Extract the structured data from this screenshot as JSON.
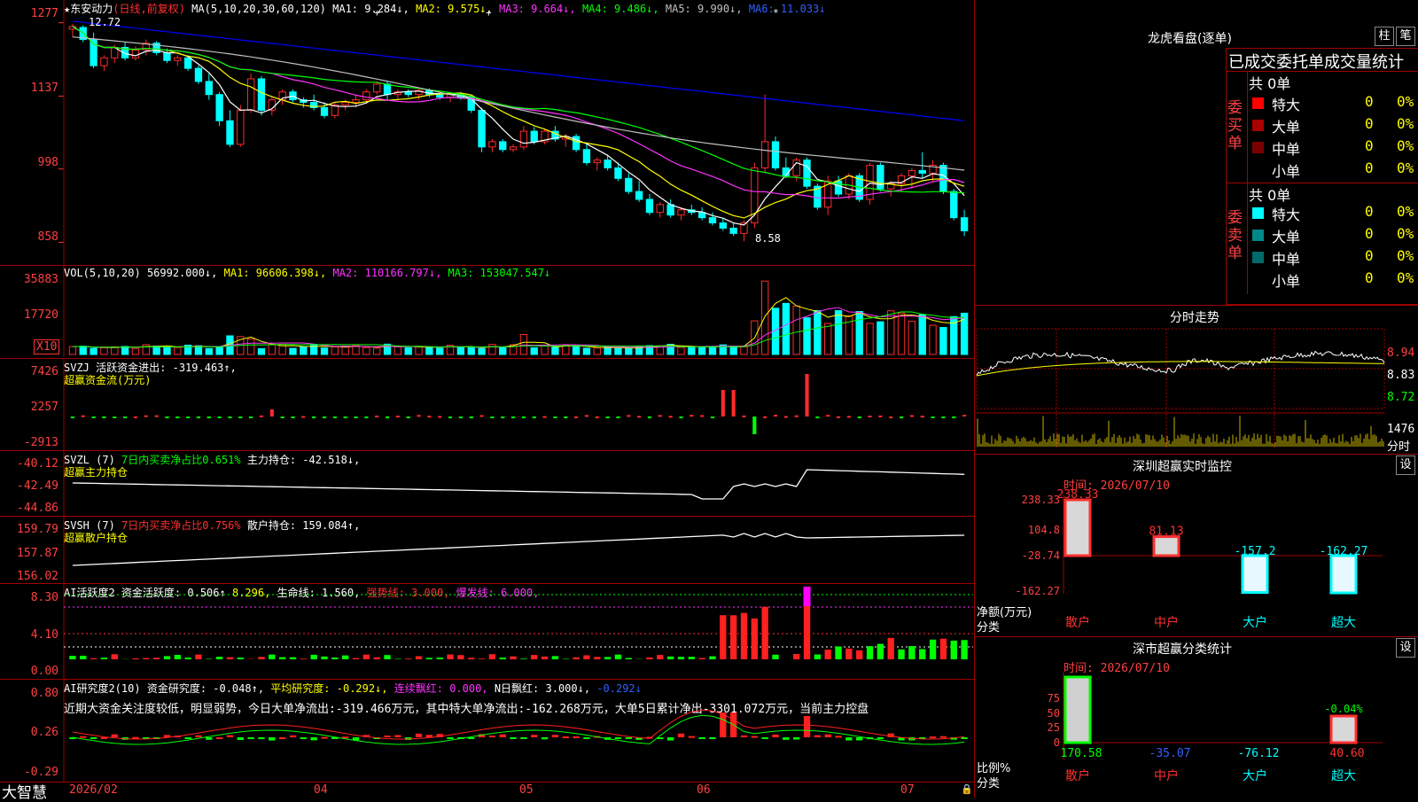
{
  "title_bar": {
    "stock_name": "东安动力",
    "period": "(日线,前复权)",
    "ma_label": "MA(5,10,20,30,60,120)",
    "ma1": "MA1: 9.284↓,",
    "ma2": "MA2: 9.575↓,",
    "ma3": "MA3: 9.664↓,",
    "ma4": "MA4: 9.486↓,",
    "ma5": "MA5: 9.990↓,",
    "ma6": "MA6: 11.033↓",
    "high_label": "12.72",
    "low_label": "8.58"
  },
  "price_axis": [
    "1277",
    "1137",
    "998",
    "858"
  ],
  "vol_panel": {
    "label": "VOL(5,10,20)",
    "value": "56992.000↓,",
    "ma1": "MA1: 96606.398↓,",
    "ma2": "MA2: 110166.797↓,",
    "ma3": "MA3: 153047.547↓",
    "axis": [
      "35883",
      "17720"
    ],
    "unit": "X10"
  },
  "svzj_panel": {
    "label": "SVZJ",
    "text": "活跃资金进出: -319.463↑,",
    "sub": "超赢资金流(万元)",
    "axis": [
      "7426",
      "2257",
      "-2913"
    ]
  },
  "svzl_panel": {
    "label": "SVZL (7)",
    "text1": "7日内买卖净占比0.651%",
    "text2": "主力持仓: -42.518↓,",
    "sub": "超赢主力持仓",
    "axis": [
      "-40.12",
      "-42.49",
      "-44.86"
    ]
  },
  "svsh_panel": {
    "label": "SVSH (7)",
    "text1": "7日内买卖净占比0.756%",
    "text2": "散户持仓: 159.084↑,",
    "sub": "超赢散户持仓",
    "axis": [
      "159.79",
      "157.87",
      "156.02"
    ]
  },
  "ai1_panel": {
    "label": "AI活跃度2",
    "t1": "资金活跃度: 0.506↑",
    "t2": "8.296,",
    "t3": "生命线: 1.560,",
    "t4": "强势线: 3.000,",
    "t5": "爆发线: 6.000,",
    "axis": [
      "8.30",
      "4.10",
      "0.00"
    ]
  },
  "ai2_panel": {
    "label": "AI研究度2(10)",
    "t1": "资金研究度: -0.048↑,",
    "t2": "平均研究度: -0.292↓,",
    "t3": "连续飘红: 0.000,",
    "t4": "N日飘红: 3.000↓,",
    "t5": "-0.292↓",
    "axis": [
      "0.80",
      "0.26",
      "-0.29"
    ],
    "comment": "近期大资金关注度较低，明显弱势，今日大单净流出:-319.466万元，其中特大单净流出:-162.268万元，大单5日累计净出-3301.072万元，当前主力控盘"
  },
  "date_axis": [
    "2026/02",
    "04",
    "05",
    "06",
    "07"
  ],
  "brand": "大智慧",
  "dragon_tiger": {
    "title": "龙虎看盘(逐单)",
    "btn1": "柱",
    "btn2": "笔",
    "header": "已成交委托单成交量统计",
    "buy_label": "委买单",
    "sell_label": "委卖单",
    "buy_total": "共 0单",
    "sell_total": "共 0单",
    "rows": [
      "特大",
      "大单",
      "中单",
      "小单"
    ],
    "count": "0",
    "pct": "0%"
  },
  "intraday": {
    "title": "分时走势",
    "price_axis": [
      "8.94",
      "8.83",
      "8.72"
    ],
    "vol_axis": "1476",
    "vol_unit": "分时"
  },
  "realtime_monitor": {
    "title": "深圳超赢实时监控",
    "btn": "设",
    "time": "时间: 2026/07/10",
    "axis": [
      "238.33",
      "104.8",
      "-28.74",
      "-162.27"
    ],
    "unit_label": "净额(万元)",
    "cat_label": "分类",
    "categories": [
      "散户",
      "中户",
      "大户",
      "超大"
    ],
    "values": [
      "238.33",
      "81.13",
      "-157.2",
      "-162.27"
    ]
  },
  "class_stats": {
    "title": "深市超赢分类统计",
    "btn": "设",
    "time": "时间: 2026/07/10",
    "axis": [
      "75",
      "50",
      "25",
      "0"
    ],
    "ratio_label": "比例%",
    "cat_label": "分类",
    "categories": [
      "散户",
      "中户",
      "大户",
      "超大"
    ],
    "values": [
      "170.58",
      "-35.07",
      "-76.12",
      "40.60"
    ],
    "top_label": "-0.04%"
  },
  "chart_data": [
    {
      "type": "candlestick",
      "name": "daily-kline",
      "x_start": "2026/02",
      "ylim": [
        830,
        1290
      ],
      "candles": [
        [
          1265,
          1275,
          1250,
          1270
        ],
        [
          1268,
          1272,
          1240,
          1245
        ],
        [
          1245,
          1258,
          1190,
          1195
        ],
        [
          1195,
          1215,
          1185,
          1210
        ],
        [
          1210,
          1235,
          1200,
          1230
        ],
        [
          1230,
          1240,
          1205,
          1210
        ],
        [
          1210,
          1232,
          1205,
          1225
        ],
        [
          1225,
          1245,
          1215,
          1238
        ],
        [
          1238,
          1242,
          1215,
          1220
        ],
        [
          1220,
          1228,
          1200,
          1205
        ],
        [
          1205,
          1215,
          1195,
          1210
        ],
        [
          1210,
          1215,
          1185,
          1190
        ],
        [
          1190,
          1195,
          1160,
          1165
        ],
        [
          1165,
          1180,
          1130,
          1140
        ],
        [
          1140,
          1145,
          1080,
          1090
        ],
        [
          1090,
          1110,
          1040,
          1045
        ],
        [
          1045,
          1120,
          1040,
          1110
        ],
        [
          1110,
          1180,
          1105,
          1170
        ],
        [
          1170,
          1175,
          1100,
          1110
        ],
        [
          1110,
          1135,
          1100,
          1130
        ],
        [
          1130,
          1150,
          1120,
          1145
        ],
        [
          1145,
          1150,
          1125,
          1130
        ],
        [
          1130,
          1135,
          1115,
          1125
        ],
        [
          1125,
          1140,
          1110,
          1115
        ],
        [
          1115,
          1125,
          1095,
          1100
        ],
        [
          1100,
          1125,
          1095,
          1120
        ],
        [
          1120,
          1130,
          1110,
          1125
        ],
        [
          1125,
          1140,
          1115,
          1130
        ],
        [
          1130,
          1150,
          1125,
          1145
        ],
        [
          1145,
          1165,
          1140,
          1160
        ],
        [
          1160,
          1165,
          1130,
          1140
        ],
        [
          1140,
          1150,
          1130,
          1145
        ],
        [
          1145,
          1150,
          1135,
          1140
        ],
        [
          1140,
          1150,
          1130,
          1148
        ],
        [
          1148,
          1152,
          1135,
          1140
        ],
        [
          1140,
          1145,
          1130,
          1135
        ],
        [
          1135,
          1145,
          1125,
          1140
        ],
        [
          1140,
          1145,
          1130,
          1135
        ],
        [
          1135,
          1140,
          1105,
          1110
        ],
        [
          1110,
          1115,
          1030,
          1040
        ],
        [
          1040,
          1055,
          1030,
          1050
        ],
        [
          1050,
          1055,
          1030,
          1035
        ],
        [
          1035,
          1045,
          1030,
          1040
        ],
        [
          1040,
          1080,
          1035,
          1070
        ],
        [
          1070,
          1078,
          1045,
          1050
        ],
        [
          1050,
          1075,
          1045,
          1070
        ],
        [
          1070,
          1080,
          1050,
          1055
        ],
        [
          1055,
          1065,
          1040,
          1060
        ],
        [
          1060,
          1065,
          1030,
          1035
        ],
        [
          1035,
          1045,
          1005,
          1010
        ],
        [
          1010,
          1020,
          995,
          1015
        ],
        [
          1015,
          1025,
          995,
          1000
        ],
        [
          1000,
          1010,
          975,
          980
        ],
        [
          980,
          990,
          950,
          955
        ],
        [
          955,
          975,
          935,
          940
        ],
        [
          940,
          950,
          910,
          915
        ],
        [
          915,
          935,
          905,
          930
        ],
        [
          930,
          940,
          905,
          910
        ],
        [
          910,
          925,
          900,
          920
        ],
        [
          920,
          930,
          910,
          915
        ],
        [
          915,
          925,
          900,
          905
        ],
        [
          905,
          915,
          890,
          895
        ],
        [
          895,
          905,
          880,
          885
        ],
        [
          885,
          895,
          870,
          875
        ],
        [
          875,
          900,
          860,
          895
        ],
        [
          895,
          1010,
          885,
          1000
        ],
        [
          1000,
          1140,
          990,
          1050
        ],
        [
          1050,
          1060,
          995,
          1000
        ],
        [
          1000,
          1020,
          980,
          985
        ],
        [
          985,
          1020,
          975,
          1015
        ],
        [
          1015,
          1020,
          960,
          965
        ],
        [
          965,
          970,
          920,
          925
        ],
        [
          925,
          985,
          910,
          975
        ],
        [
          975,
          985,
          945,
          950
        ],
        [
          950,
          990,
          940,
          985
        ],
        [
          985,
          990,
          935,
          940
        ],
        [
          940,
          1010,
          930,
          1005
        ],
        [
          1005,
          1010,
          955,
          960
        ],
        [
          960,
          975,
          945,
          970
        ],
        [
          970,
          990,
          955,
          985
        ],
        [
          985,
          1000,
          960,
          995
        ],
        [
          995,
          1030,
          980,
          990
        ],
        [
          990,
          1015,
          975,
          1005
        ],
        [
          1005,
          1010,
          950,
          955
        ],
        [
          955,
          960,
          900,
          905
        ],
        [
          905,
          920,
          870,
          880
        ]
      ],
      "moving_averages": [
        "MA1",
        "MA2",
        "MA3",
        "MA4",
        "MA5",
        "MA6"
      ]
    }
  ],
  "colors": {
    "up": "#ff2a2a",
    "down": "#00ffff",
    "border": "#a00000",
    "ma1": "#ffffff",
    "ma2": "#ffff00",
    "ma3": "#ff33ff",
    "ma4": "#00ff00",
    "ma5": "#c0c0c0",
    "ma6": "#0000ff"
  }
}
